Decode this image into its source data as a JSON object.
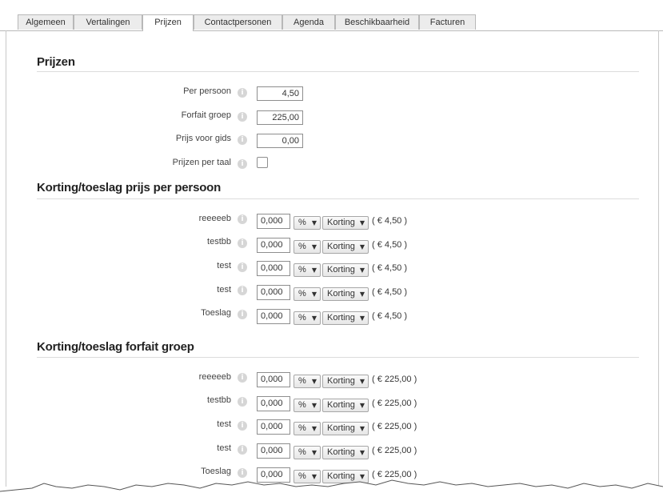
{
  "tabs": [
    {
      "label": "Algemeen",
      "active": false
    },
    {
      "label": "Vertalingen",
      "active": false
    },
    {
      "label": "Prijzen",
      "active": true
    },
    {
      "label": "Contactpersonen",
      "active": false
    },
    {
      "label": "Agenda",
      "active": false
    },
    {
      "label": "Beschikbaarheid",
      "active": false
    },
    {
      "label": "Facturen",
      "active": false
    }
  ],
  "info_glyph": "i",
  "caret": "▼",
  "prijzen": {
    "title": "Prijzen",
    "fields": [
      {
        "label": "Per persoon",
        "value": "4,50"
      },
      {
        "label": "Forfait groep",
        "value": "225,00"
      },
      {
        "label": "Prijs voor gids",
        "value": "0,00"
      }
    ],
    "per_taal": {
      "label": "Prijzen per taal",
      "checked": false
    }
  },
  "korting_persoon": {
    "title": "Korting/toeslag prijs per persoon",
    "rows": [
      {
        "label": "reeeeeb",
        "value": "0,000",
        "unit": "%",
        "type": "Korting",
        "amount": "( € 4,50 )"
      },
      {
        "label": "testbb",
        "value": "0,000",
        "unit": "%",
        "type": "Korting",
        "amount": "( € 4,50 )"
      },
      {
        "label": "test",
        "value": "0,000",
        "unit": "%",
        "type": "Korting",
        "amount": "( € 4,50 )"
      },
      {
        "label": "test",
        "value": "0,000",
        "unit": "%",
        "type": "Korting",
        "amount": "( € 4,50 )"
      },
      {
        "label": "Toeslag",
        "value": "0,000",
        "unit": "%",
        "type": "Korting",
        "amount": "( € 4,50 )"
      }
    ]
  },
  "korting_groep": {
    "title": "Korting/toeslag forfait groep",
    "rows": [
      {
        "label": "reeeeeb",
        "value": "0,000",
        "unit": "%",
        "type": "Korting",
        "amount": "( € 225,00 )"
      },
      {
        "label": "testbb",
        "value": "0,000",
        "unit": "%",
        "type": "Korting",
        "amount": "( € 225,00 )"
      },
      {
        "label": "test",
        "value": "0,000",
        "unit": "%",
        "type": "Korting",
        "amount": "( € 225,00 )"
      },
      {
        "label": "test",
        "value": "0,000",
        "unit": "%",
        "type": "Korting",
        "amount": "( € 225,00 )"
      },
      {
        "label": "Toeslag",
        "value": "0,000",
        "unit": "%",
        "type": "Korting",
        "amount": "( € 225,00 )"
      }
    ]
  }
}
